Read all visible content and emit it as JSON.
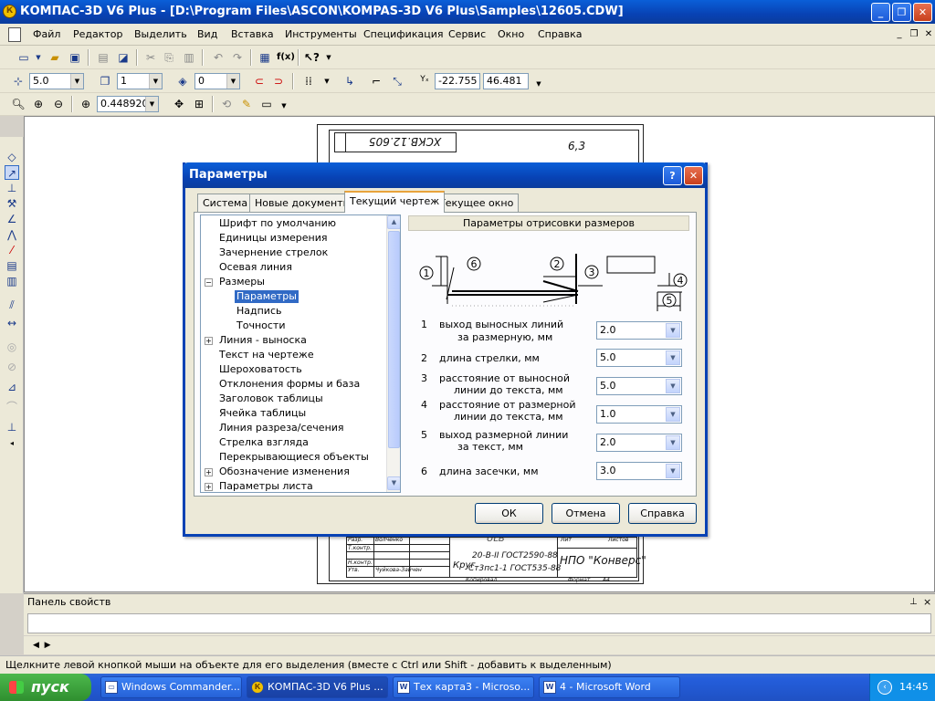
{
  "window": {
    "title": "КОМПАС-3D V6 Plus - [D:\\Program Files\\ASCON\\KOMPAS-3D V6 Plus\\Samples\\12605.CDW]",
    "app_icon": "kompas-icon"
  },
  "menu": [
    "Файл",
    "Редактор",
    "Выделить",
    "Вид",
    "Вставка",
    "Инструменты",
    "Спецификация",
    "Сервис",
    "Окно",
    "Справка"
  ],
  "toolbar": {
    "step": "5.0",
    "layer": "1",
    "style": "0",
    "x_coord": "-22.755",
    "y_coord": "46.481",
    "zoom": "0.448920"
  },
  "sheet": {
    "stamp_title": "ХСКВ.12.605",
    "roughness": "6,3",
    "label_ul": "ULB",
    "material_line1": "20-В-II ГОСТ2590-88",
    "material_line2": "Ст3пс1-1 ГОСТ535-88",
    "material_prefix": "Круг",
    "org": "НПО \"Конверс\"",
    "role_1": "Разр.",
    "name_1": "Волченко",
    "role_2": "Т.контр.",
    "role_3": "Н.контр.",
    "role_4": "Утв.",
    "name_4": "Чуйкова-Зайчен",
    "col_lit": "Лит",
    "col_sheets": "Листов",
    "copied": "Копировал",
    "format": "Формат",
    "format_val": "A4"
  },
  "panel": {
    "properties_title": "Панель свойств",
    "pin": "⊥",
    "close": "×"
  },
  "status": "Щелкните левой кнопкой мыши на объекте для его выделения (вместе с Ctrl или Shift - добавить к выделенным)",
  "dialog": {
    "title": "Параметры",
    "help_btn": "?",
    "close_btn": "✕",
    "tabs": [
      "Система",
      "Новые документы",
      "Текущий чертеж",
      "Текущее окно"
    ],
    "active_tab": "Текущий чертеж",
    "tree": [
      "Шрифт по умолчанию",
      "Единицы измерения",
      "Зачернение стрелок",
      "Осевая линия",
      "Размеры",
      "Параметры",
      "Надпись",
      "Точности",
      "Линия - выноска",
      "Текст на чертеже",
      "Шероховатость",
      "Отклонения формы и база",
      "Заголовок таблицы",
      "Ячейка таблицы",
      "Линия разреза/сечения",
      "Стрелка взгляда",
      "Перекрывающиеся объекты",
      "Обозначение изменения",
      "Параметры листа"
    ],
    "tree_expanders": {
      "collapse": "−",
      "expand": "+"
    },
    "selected_node": "Параметры",
    "section_title": "Параметры отрисовки размеров",
    "diagram_labels": [
      "1",
      "2",
      "3",
      "4",
      "5",
      "6"
    ],
    "params": [
      {
        "num": "1",
        "label1": "выход выносных линий",
        "label2": "за размерную, мм",
        "value": "2.0"
      },
      {
        "num": "2",
        "label1": "длина стрелки, мм",
        "label2": "",
        "value": "5.0"
      },
      {
        "num": "3",
        "label1": "расстояние от выносной",
        "label2": "линии до текста, мм",
        "value": "5.0"
      },
      {
        "num": "4",
        "label1": "расстояние от размерной",
        "label2": "линии до текста, мм",
        "value": "1.0"
      },
      {
        "num": "5",
        "label1": "выход размерной линии",
        "label2": "за текст, мм",
        "value": "2.0"
      },
      {
        "num": "6",
        "label1": "длина засечки, мм",
        "label2": "",
        "value": "3.0"
      }
    ],
    "buttons": {
      "ok": "ОК",
      "cancel": "Отмена",
      "help": "Справка"
    }
  },
  "taskbar": {
    "start": "пуск",
    "tasks": [
      {
        "label": "Windows Commander...",
        "icon": "folder-icon"
      },
      {
        "label": "КОМПАС-3D V6 Plus ...",
        "icon": "kompas-icon"
      },
      {
        "label": "Тех карта3 - Microso...",
        "icon": "word-icon"
      },
      {
        "label": "4 - Microsoft Word",
        "icon": "word-icon"
      }
    ],
    "clock": "14:45"
  }
}
